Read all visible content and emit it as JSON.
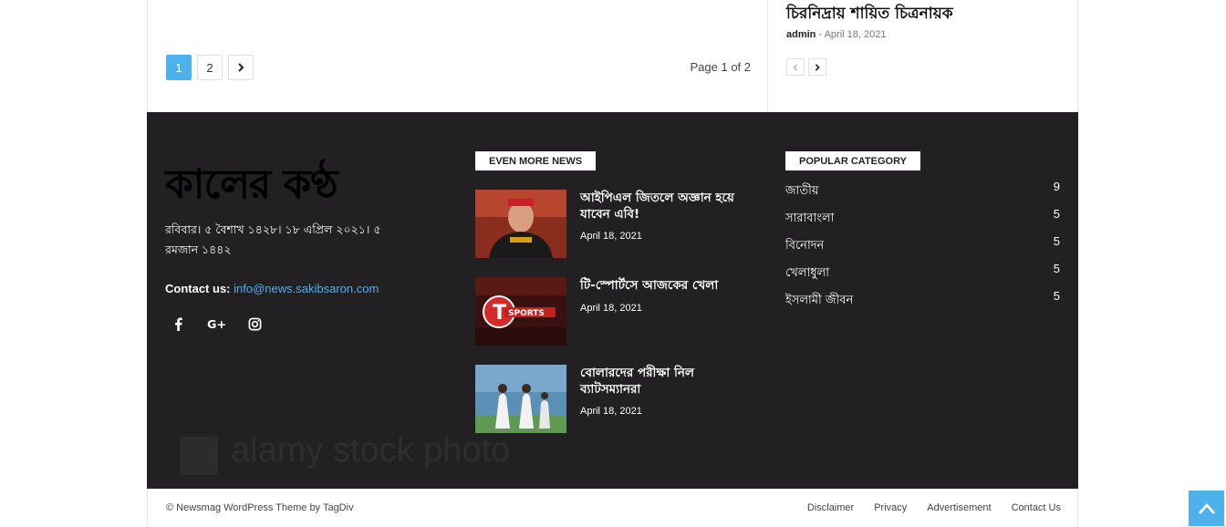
{
  "pagination": {
    "pages": [
      "1",
      "2"
    ],
    "active": "1",
    "next_icon": "chevron-right-icon",
    "page_count": "Page 1 of 2"
  },
  "sidebar_post": {
    "title": "চিরনিদ্রায় শায়িত চিত্রনায়ক",
    "author": "admin",
    "separator": "-",
    "date": "April 18, 2021"
  },
  "footer": {
    "logo": "কালের কণ্ঠ",
    "date_line": "রবিবার। ৫ বৈশাখ ১৪২৮। ১৮ এপ্রিল ২০২১। ৫ রমজান ১৪৪২",
    "contact_label": "Contact us:",
    "contact_email": "info@news.sakibsaron.com",
    "social": [
      "facebook-icon",
      "google-plus-icon",
      "instagram-icon"
    ],
    "more_news_title": "EVEN MORE NEWS",
    "news": [
      {
        "title": "আইপিএল জিতলে অজ্ঞান হয়ে যাবেন এবি!",
        "date": "April 18, 2021"
      },
      {
        "title": "টি-স্পোর্টসে আজকের খেলা",
        "date": "April 18, 2021"
      },
      {
        "title": "বোলারদের পরীক্ষা নিল ব্যাটসম্যানরা",
        "date": "April 18, 2021"
      }
    ],
    "thumb_text": "T SPORTS",
    "popular_title": "POPULAR CATEGORY",
    "categories": [
      {
        "name": "জাতীয়",
        "count": "9"
      },
      {
        "name": "সারাবাংলা",
        "count": "5"
      },
      {
        "name": "বিনোদন",
        "count": "5"
      },
      {
        "name": "খেলাধুলা",
        "count": "5"
      },
      {
        "name": "ইসলামী জীবন",
        "count": "5"
      }
    ],
    "watermark": "alamy stock photo"
  },
  "subfooter": {
    "copyright": "© Newsmag WordPress Theme by TagDiv",
    "menu": [
      "Disclaimer",
      "Privacy",
      "Advertisement",
      "Contact Us"
    ]
  },
  "colors": {
    "accent": "#4db2ec",
    "footer_bg": "#222022"
  }
}
